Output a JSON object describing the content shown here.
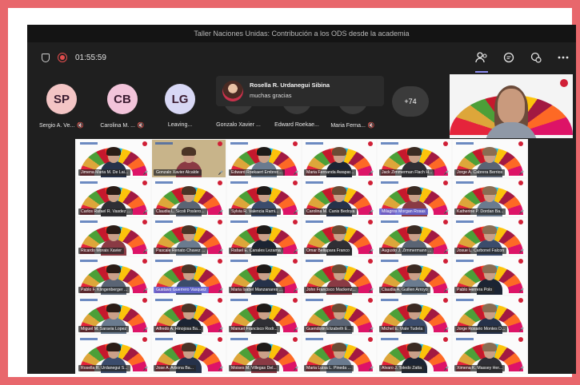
{
  "window": {
    "title": "Taller Naciones Unidas: Contribución a los ODS desde la academia"
  },
  "toolbar": {
    "timer": "01:55:59",
    "icons": [
      "shield-icon",
      "record-icon",
      "people-icon",
      "chat-icon",
      "reactions-icon",
      "more-icon"
    ]
  },
  "strip": {
    "participants": [
      {
        "initials": "SP",
        "name": "Sergio A. Ve...",
        "muted": true,
        "color": "#f3c5c5"
      },
      {
        "initials": "CB",
        "name": "Carolina M. ...",
        "muted": true,
        "color": "#f2c4da"
      },
      {
        "initials": "LG",
        "name": "Leaving...",
        "muted": false,
        "color": "#d8d8f5"
      },
      {
        "initials": "",
        "name": "Gonzalo Xavier ...",
        "muted": false,
        "color": ""
      },
      {
        "initials": "",
        "name": "Edward Roekae...",
        "muted": false,
        "color": ""
      },
      {
        "initials": "",
        "name": "Maria Ferna...",
        "muted": true,
        "color": ""
      }
    ],
    "more_count": "+74"
  },
  "chat_toast": {
    "sender": "Rosella R. Urdanegui Sibina",
    "message": "muchas gracias"
  },
  "grid": {
    "rows": [
      [
        "Jimena Maria M. De Lai...",
        "Gonzalo Xavier Alcalde",
        "Edward Roekaert Embrec...",
        "Maria Fernanda Awapar...",
        "Jack Zimmerman Flach H...",
        "Jorge A. Cabrera Berrios"
      ],
      [
        "Carlos Rafael R. Vasdez ...",
        "Claudia L. Sicoli Poslero...",
        "Sylvia R. Valencia Rami...",
        "Carolina M. Canis Bedoya",
        "Milagros Morgan Rosas",
        "Katherine P. Dordan Ba..."
      ],
      [
        "Ricardo Morais Xavier",
        "Pascale Renato Chavez ...",
        "Rafael E. Canales Lezama",
        "Omar Bellapara Franco",
        "Augusto J. Zimmermann ...",
        "Josue L. Carbonel Falcon"
      ],
      [
        "Pablo F. Klingenberger ...",
        "Gustavo Guerrero Vasquez",
        "Maria Isabel Manzanares ...",
        "John Francisco Mackenz...",
        "Claudia A. Guillen Arroyo",
        "Pablo Herrera Polo"
      ],
      [
        "Miguel M. Saravia Lopez",
        "Alfredo A. Hinojosa Ba...",
        "Manuel Francisco Rodr...",
        "Guendolin Elizabeth E...",
        "Michel E. Viale Tudela",
        "Jorge Rosario Montes D..."
      ],
      [
        "Rosella R. Urdanegui S...",
        "Jose A. Arbona Ba...",
        "Moises M. Villegas Del...",
        "Maria Luisa L. Pineda ...",
        "Alvaro J. Toledo Zatta",
        "Ximena K. Massey Her..."
      ]
    ],
    "highlighted": [
      "Milagros Morgan Rosas",
      "Gustavo Guerrero Vasquez"
    ]
  }
}
